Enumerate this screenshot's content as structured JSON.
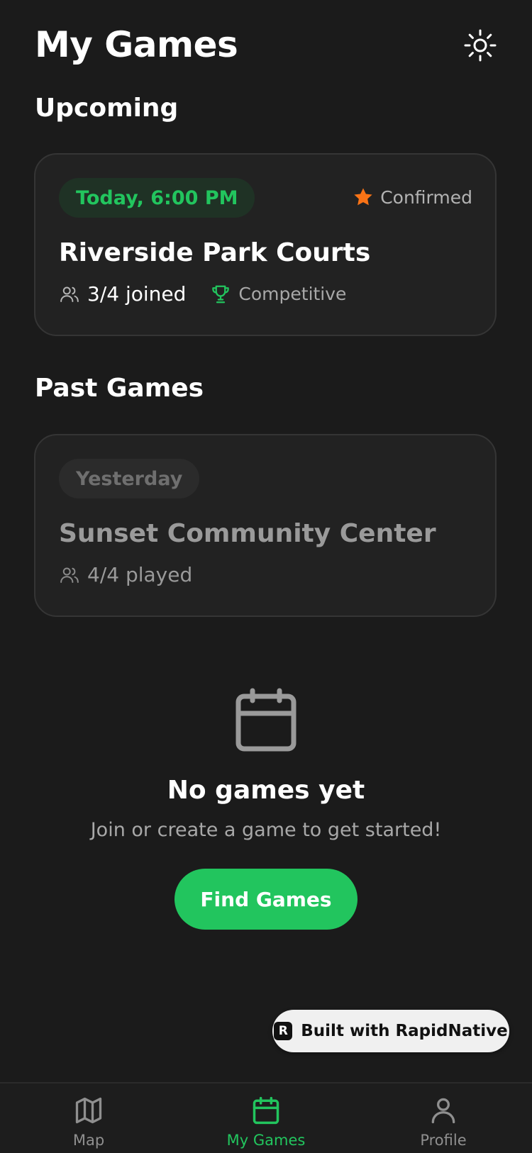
{
  "header": {
    "title": "My Games",
    "theme_icon": "sun-icon"
  },
  "sections": {
    "upcoming_title": "Upcoming",
    "past_title": "Past Games"
  },
  "upcoming_game": {
    "when": "Today, 6:00 PM",
    "status": "Confirmed",
    "status_icon": "star-icon",
    "venue": "Riverside Park Courts",
    "players": "3/4 joined",
    "players_icon": "users-icon",
    "level": "Competitive",
    "level_icon": "trophy-icon"
  },
  "past_game": {
    "when": "Yesterday",
    "venue": "Sunset Community Center",
    "players": "4/4 played",
    "players_icon": "users-icon"
  },
  "empty_state": {
    "icon": "calendar-icon",
    "title": "No games yet",
    "subtitle": "Join or create a game to get started!",
    "button": "Find Games"
  },
  "badge": {
    "label": "Built with RapidNative",
    "logo": "R"
  },
  "tabs": [
    {
      "label": "Map",
      "icon": "map-icon",
      "active": false
    },
    {
      "label": "My Games",
      "icon": "calendar-icon",
      "active": true
    },
    {
      "label": "Profile",
      "icon": "user-icon",
      "active": false
    }
  ],
  "colors": {
    "background": "#1b1b1b",
    "card": "#222222",
    "accent": "#22c55e",
    "star": "#f97316",
    "muted": "#9a9a9a",
    "inactive_tab": "#8f8f8f"
  }
}
